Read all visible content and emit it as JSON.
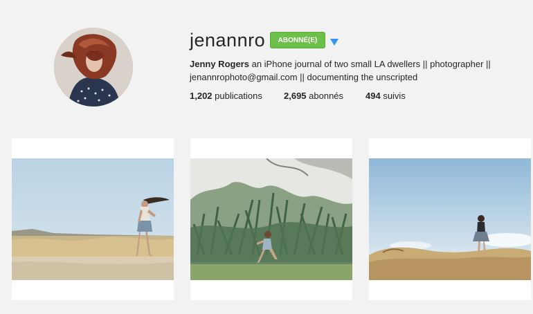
{
  "profile": {
    "username": "jenannro",
    "follow_button_label": "ABONNÉ(E)",
    "full_name": "Jenny Rogers",
    "bio_line1": " an iPhone journal of two small LA dwellers || photographer ||",
    "bio_line2": "jenannrophoto@gmail.com || documenting the unscripted"
  },
  "stats": {
    "posts_count": "1,202",
    "posts_label": " publications",
    "followers_count": "2,695",
    "followers_label": " abonnés",
    "following_count": "494",
    "following_label": " suivis"
  },
  "colors": {
    "follow_button": "#6cc04a",
    "dropdown_arrow": "#3897f0",
    "background": "#f2f2f2"
  },
  "icons": {
    "dropdown": "triangle-down-icon"
  }
}
